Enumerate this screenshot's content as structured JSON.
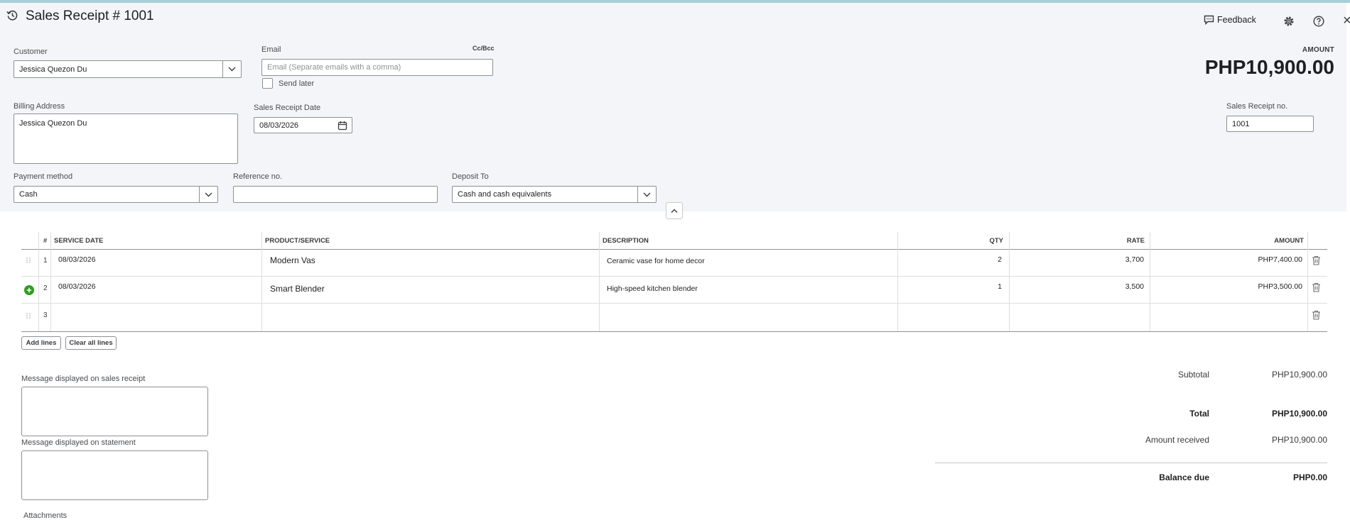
{
  "header": {
    "title": "Sales Receipt # 1001",
    "feedback_label": "Feedback",
    "amount_label": "AMOUNT",
    "amount_value": "PHP10,900.00",
    "close_symbol": "×"
  },
  "form": {
    "customer_label": "Customer",
    "customer_value": "Jessica Quezon Du",
    "email_label": "Email",
    "ccbcc_label": "Cc/Bcc",
    "email_placeholder": "Email (Separate emails with a comma)",
    "send_later_label": "Send later",
    "billing_address_label": "Billing Address",
    "billing_address_value": "Jessica Quezon Du",
    "receipt_date_label": "Sales Receipt Date",
    "receipt_date_value": "08/03/2026",
    "receipt_no_label": "Sales Receipt no.",
    "receipt_no_value": "1001",
    "payment_method_label": "Payment method",
    "payment_method_value": "Cash",
    "reference_label": "Reference no.",
    "reference_value": "",
    "deposit_to_label": "Deposit To",
    "deposit_to_value": "Cash and cash equivalents"
  },
  "table": {
    "columns": {
      "num": "#",
      "service_date": "SERVICE DATE",
      "product": "PRODUCT/SERVICE",
      "description": "DESCRIPTION",
      "qty": "QTY",
      "rate": "RATE",
      "amount": "AMOUNT"
    },
    "rows": [
      {
        "num": "1",
        "service_date": "08/03/2026",
        "product": "Modern Vas",
        "description": "Ceramic vase for home decor",
        "qty": "2",
        "rate": "3,700",
        "amount": "PHP7,400.00"
      },
      {
        "num": "2",
        "service_date": "08/03/2026",
        "product": "Smart Blender",
        "description": "High-speed kitchen blender",
        "qty": "1",
        "rate": "3,500",
        "amount": "PHP3,500.00"
      },
      {
        "num": "3",
        "service_date": "",
        "product": "",
        "description": "",
        "qty": "",
        "rate": "",
        "amount": ""
      }
    ],
    "add_lines_label": "Add lines",
    "clear_lines_label": "Clear all lines"
  },
  "messages": {
    "sales_receipt_label": "Message displayed on sales receipt",
    "statement_label": "Message displayed on statement",
    "attachments_label": "Attachments"
  },
  "summary": {
    "subtotal_label": "Subtotal",
    "subtotal_value": "PHP10,900.00",
    "total_label": "Total",
    "total_value": "PHP10,900.00",
    "amount_received_label": "Amount received",
    "amount_received_value": "PHP10,900.00",
    "balance_due_label": "Balance due",
    "balance_due_value": "PHP0.00"
  },
  "colors": {
    "accent_green": "#2ca01c",
    "header_band": "#f3f5f8",
    "top_line": "#a9cfd8"
  },
  "icons": [
    "history-icon",
    "feedback-icon",
    "gear-icon",
    "help-icon",
    "close-icon",
    "chevron-down-icon",
    "calendar-icon",
    "chevron-up-icon",
    "drag-handle-icon",
    "add-row-icon",
    "trash-icon"
  ]
}
